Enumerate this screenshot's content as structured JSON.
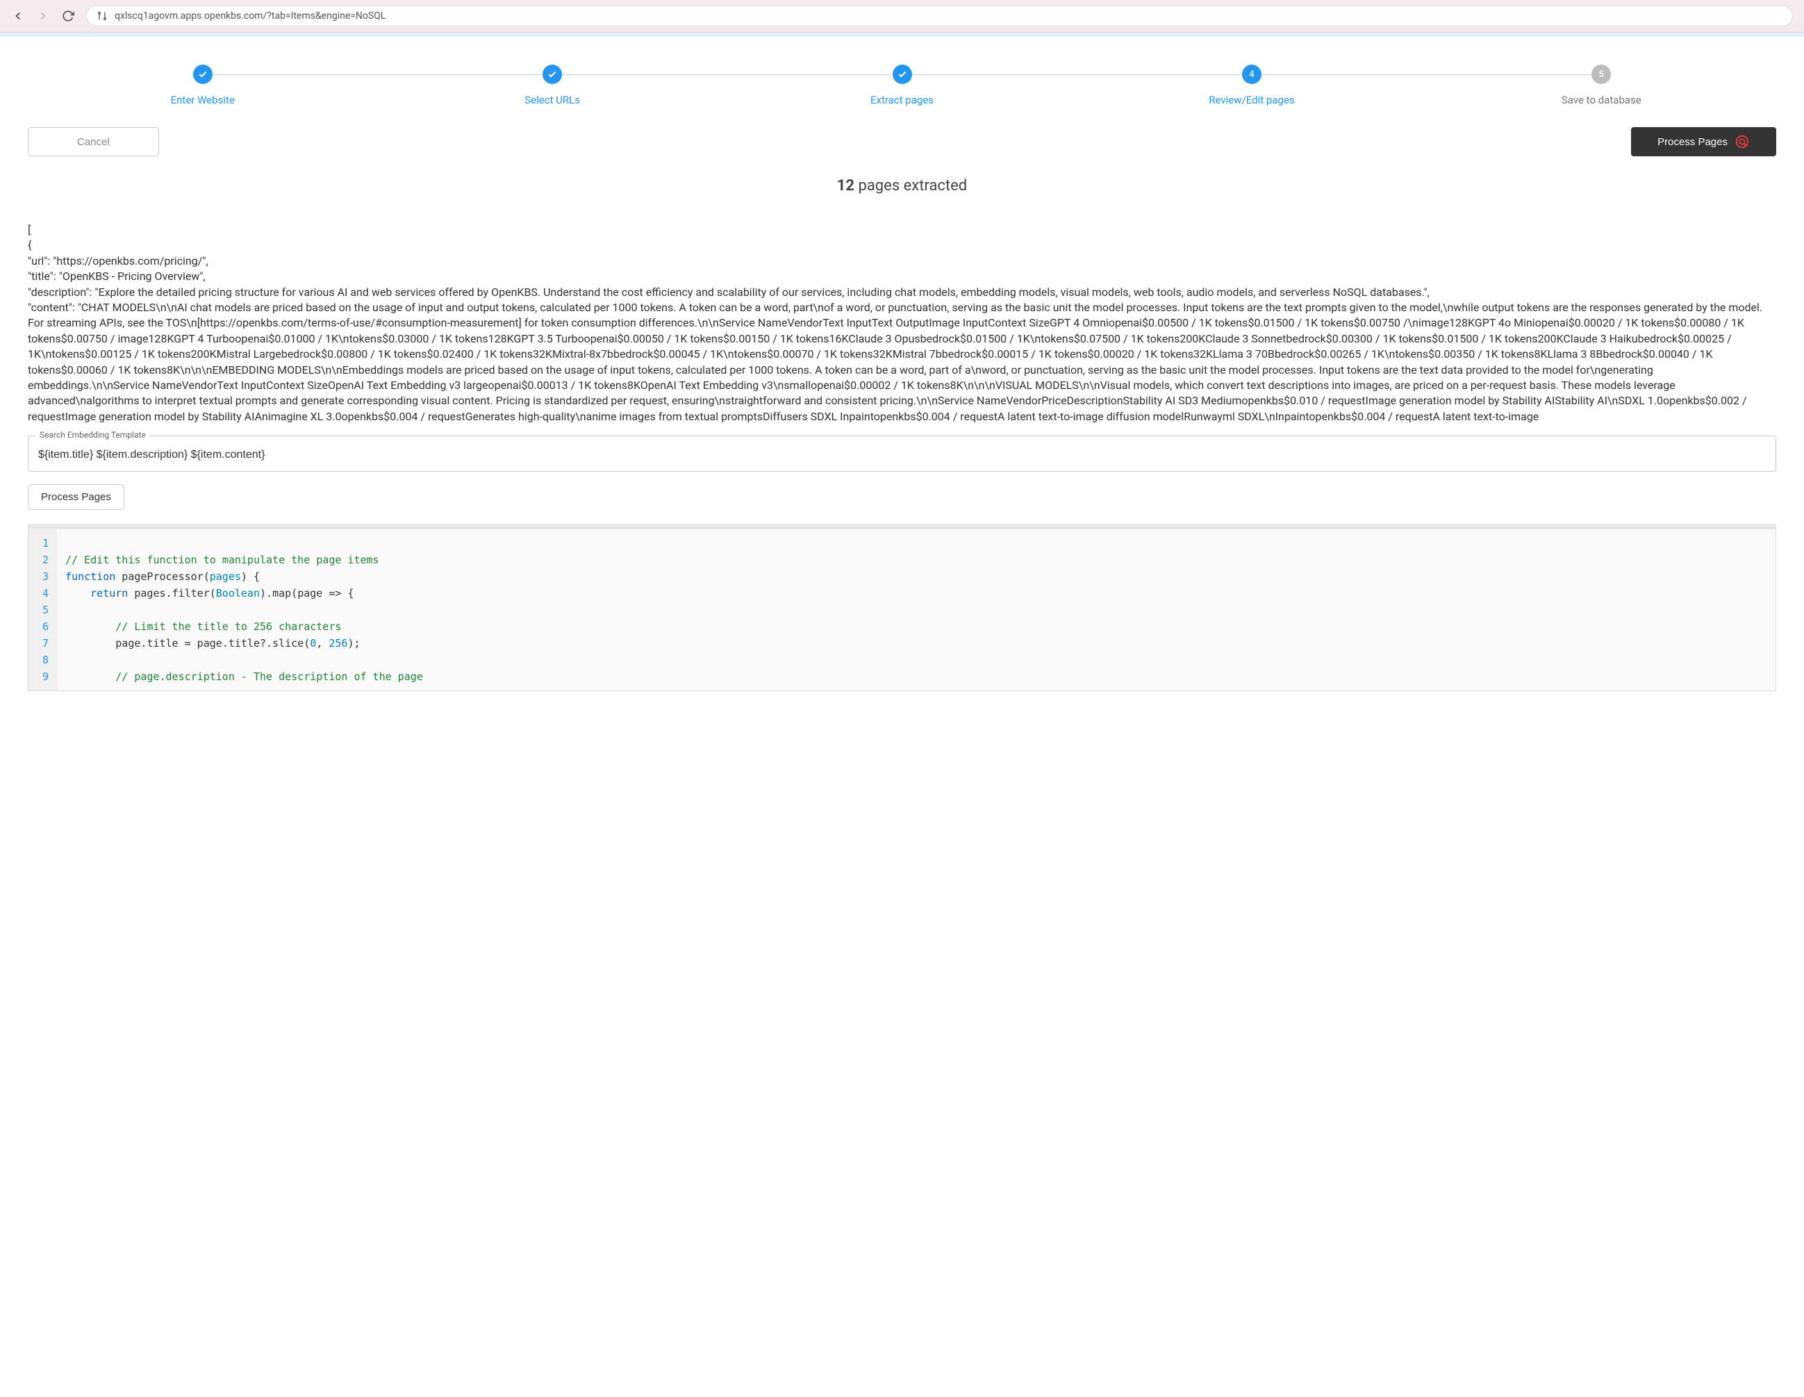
{
  "browser": {
    "url": "qxlscq1agovm.apps.openkbs.com/?tab=Items&engine=NoSQL"
  },
  "stepper": {
    "steps": [
      {
        "label": "Enter Website",
        "state": "done"
      },
      {
        "label": "Select URLs",
        "state": "done"
      },
      {
        "label": "Extract pages",
        "state": "done"
      },
      {
        "label": "Review/Edit pages",
        "state": "active",
        "num": "4"
      },
      {
        "label": "Save to database",
        "state": "future",
        "num": "5"
      }
    ]
  },
  "actions": {
    "cancel": "Cancel",
    "process_top": "Process Pages",
    "process_small": "Process Pages"
  },
  "heading": {
    "count": "12",
    "text": " pages extracted"
  },
  "json_text": "[\n{\n\"url\": \"https://openkbs.com/pricing/\",\n\"title\": \"OpenKBS - Pricing Overview\",\n\"description\": \"Explore the detailed pricing structure for various AI and web services offered by OpenKBS. Understand the cost efficiency and scalability of our services, including chat models, embedding models, visual models, web tools, audio models, and serverless NoSQL databases.\",\n\"content\": \"CHAT MODELS\\n\\nAI chat models are priced based on the usage of input and output tokens, calculated per 1000 tokens. A token can be a word, part\\nof a word, or punctuation, serving as the basic unit the model processes. Input tokens are the text prompts given to the model,\\nwhile output tokens are the responses generated by the model. For streaming APIs, see the TOS\\n[https://openkbs.com/terms-of-use/#consumption-measurement] for token consumption differences.\\n\\nService NameVendorText InputText OutputImage InputContext SizeGPT 4 Omniopenai$0.00500 / 1K tokens$0.01500 / 1K tokens$0.00750 /\\nimage128KGPT 4o Miniopenai$0.00020 / 1K tokens$0.00080 / 1K tokens$0.00750 / image128KGPT 4 Turboopenai$0.01000 / 1K\\ntokens$0.03000 / 1K tokens128KGPT 3.5 Turboopenai$0.00050 / 1K tokens$0.00150 / 1K tokens16KClaude 3 Opusbedrock$0.01500 / 1K\\ntokens$0.07500 / 1K tokens200KClaude 3 Sonnetbedrock$0.00300 / 1K tokens$0.01500 / 1K tokens200KClaude 3 Haikubedrock$0.00025 / 1K\\ntokens$0.00125 / 1K tokens200KMistral Largebedrock$0.00800 / 1K tokens$0.02400 / 1K tokens32KMixtral-8x7bbedrock$0.00045 / 1K\\ntokens$0.00070 / 1K tokens32KMistral 7bbedrock$0.00015 / 1K tokens$0.00020 / 1K tokens32KLlama 3 70Bbedrock$0.00265 / 1K\\ntokens$0.00350 / 1K tokens8KLlama 3 8Bbedrock$0.00040 / 1K tokens$0.00060 / 1K tokens8K\\n\\n\\nEMBEDDING MODELS\\n\\nEmbeddings models are priced based on the usage of input tokens, calculated per 1000 tokens. A token can be a word, part of a\\nword, or punctuation, serving as the basic unit the model processes. Input tokens are the text data provided to the model for\\ngenerating embeddings.\\n\\nService NameVendorText InputContext SizeOpenAI Text Embedding v3 largeopenai$0.00013 / 1K tokens8KOpenAI Text Embedding v3\\nsmallopenai$0.00002 / 1K tokens8K\\n\\n\\nVISUAL MODELS\\n\\nVisual models, which convert text descriptions into images, are priced on a per-request basis. These models leverage advanced\\nalgorithms to interpret textual prompts and generate corresponding visual content. Pricing is standardized per request, ensuring\\nstraightforward and consistent pricing.\\n\\nService NameVendorPriceDescriptionStability AI SD3 Mediumopenkbs$0.010 / requestImage generation model by Stability AIStability AI\\nSDXL 1.0openkbs$0.002 / requestImage generation model by Stability AIAnimagine XL 3.0openkbs$0.004 / requestGenerates high-quality\\nanime images from textual promptsDiffusers SDXL Inpaintopenkbs$0.004 / requestA latent text-to-image diffusion modelRunwayml SDXL\\nInpaintopenkbs$0.004 / requestA latent text-to-image",
  "embedding_template": {
    "legend": "Search Embedding Template",
    "value": "${item.title} ${item.description} ${item.content}"
  },
  "code": {
    "lines": [
      {
        "n": "1",
        "tokens": []
      },
      {
        "n": "2",
        "tokens": [
          {
            "t": "// Edit this function to manipulate the page items",
            "c": "comment"
          }
        ]
      },
      {
        "n": "3",
        "tokens": [
          {
            "t": "function",
            "c": "keyword"
          },
          {
            "t": " pageProcessor",
            "c": "func"
          },
          {
            "t": "(",
            "c": "paren"
          },
          {
            "t": "pages",
            "c": "builtin"
          },
          {
            "t": ") {",
            "c": "paren"
          }
        ]
      },
      {
        "n": "4",
        "tokens": [
          {
            "t": "    ",
            "c": ""
          },
          {
            "t": "return",
            "c": "keyword"
          },
          {
            "t": " pages",
            "c": "func"
          },
          {
            "t": ".",
            "c": ""
          },
          {
            "t": "filter",
            "c": "func"
          },
          {
            "t": "(",
            "c": "paren"
          },
          {
            "t": "Boolean",
            "c": "builtin"
          },
          {
            "t": ").",
            "c": "paren"
          },
          {
            "t": "map",
            "c": "func"
          },
          {
            "t": "(",
            "c": "paren"
          },
          {
            "t": "page ",
            "c": "func"
          },
          {
            "t": "=>",
            "c": ""
          },
          {
            "t": " {",
            "c": "paren"
          }
        ]
      },
      {
        "n": "5",
        "tokens": []
      },
      {
        "n": "6",
        "tokens": [
          {
            "t": "        ",
            "c": ""
          },
          {
            "t": "// Limit the title to 256 characters",
            "c": "comment"
          }
        ]
      },
      {
        "n": "7",
        "tokens": [
          {
            "t": "        page",
            "c": "func"
          },
          {
            "t": ".",
            "c": ""
          },
          {
            "t": "title ",
            "c": "func"
          },
          {
            "t": "=",
            "c": ""
          },
          {
            "t": " page",
            "c": "func"
          },
          {
            "t": ".",
            "c": ""
          },
          {
            "t": "title",
            "c": "func"
          },
          {
            "t": "?.",
            "c": ""
          },
          {
            "t": "slice",
            "c": "func"
          },
          {
            "t": "(",
            "c": "paren"
          },
          {
            "t": "0",
            "c": "num"
          },
          {
            "t": ", ",
            "c": ""
          },
          {
            "t": "256",
            "c": "num"
          },
          {
            "t": ");",
            "c": "paren"
          }
        ]
      },
      {
        "n": "8",
        "tokens": []
      },
      {
        "n": "9",
        "tokens": [
          {
            "t": "        ",
            "c": ""
          },
          {
            "t": "// page.description - The description of the page",
            "c": "comment"
          }
        ]
      }
    ]
  }
}
